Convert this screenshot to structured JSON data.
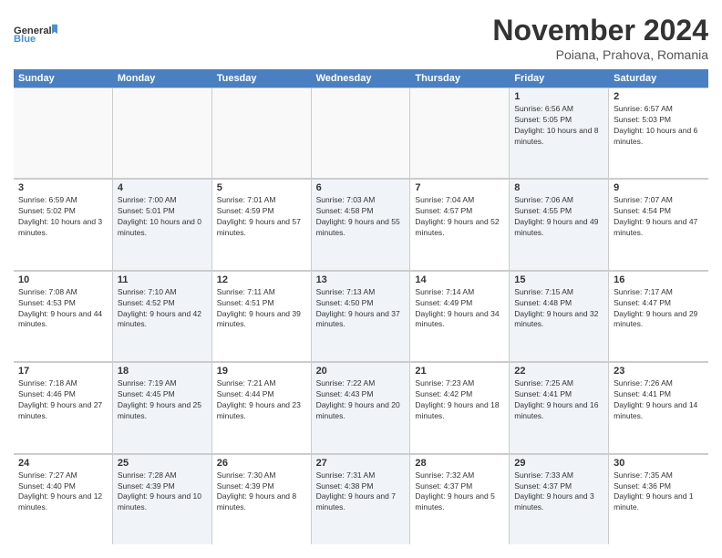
{
  "logo": {
    "general": "General",
    "blue": "Blue"
  },
  "title": "November 2024",
  "location": "Poiana, Prahova, Romania",
  "days": [
    "Sunday",
    "Monday",
    "Tuesday",
    "Wednesday",
    "Thursday",
    "Friday",
    "Saturday"
  ],
  "rows": [
    [
      {
        "day": "",
        "info": "",
        "empty": true
      },
      {
        "day": "",
        "info": "",
        "empty": true
      },
      {
        "day": "",
        "info": "",
        "empty": true
      },
      {
        "day": "",
        "info": "",
        "empty": true
      },
      {
        "day": "",
        "info": "",
        "empty": true
      },
      {
        "day": "1",
        "info": "Sunrise: 6:56 AM\nSunset: 5:05 PM\nDaylight: 10 hours and 8 minutes.",
        "shaded": true
      },
      {
        "day": "2",
        "info": "Sunrise: 6:57 AM\nSunset: 5:03 PM\nDaylight: 10 hours and 6 minutes.",
        "shaded": false
      }
    ],
    [
      {
        "day": "3",
        "info": "Sunrise: 6:59 AM\nSunset: 5:02 PM\nDaylight: 10 hours and 3 minutes.",
        "shaded": false
      },
      {
        "day": "4",
        "info": "Sunrise: 7:00 AM\nSunset: 5:01 PM\nDaylight: 10 hours and 0 minutes.",
        "shaded": true
      },
      {
        "day": "5",
        "info": "Sunrise: 7:01 AM\nSunset: 4:59 PM\nDaylight: 9 hours and 57 minutes.",
        "shaded": false
      },
      {
        "day": "6",
        "info": "Sunrise: 7:03 AM\nSunset: 4:58 PM\nDaylight: 9 hours and 55 minutes.",
        "shaded": true
      },
      {
        "day": "7",
        "info": "Sunrise: 7:04 AM\nSunset: 4:57 PM\nDaylight: 9 hours and 52 minutes.",
        "shaded": false
      },
      {
        "day": "8",
        "info": "Sunrise: 7:06 AM\nSunset: 4:55 PM\nDaylight: 9 hours and 49 minutes.",
        "shaded": true
      },
      {
        "day": "9",
        "info": "Sunrise: 7:07 AM\nSunset: 4:54 PM\nDaylight: 9 hours and 47 minutes.",
        "shaded": false
      }
    ],
    [
      {
        "day": "10",
        "info": "Sunrise: 7:08 AM\nSunset: 4:53 PM\nDaylight: 9 hours and 44 minutes.",
        "shaded": false
      },
      {
        "day": "11",
        "info": "Sunrise: 7:10 AM\nSunset: 4:52 PM\nDaylight: 9 hours and 42 minutes.",
        "shaded": true
      },
      {
        "day": "12",
        "info": "Sunrise: 7:11 AM\nSunset: 4:51 PM\nDaylight: 9 hours and 39 minutes.",
        "shaded": false
      },
      {
        "day": "13",
        "info": "Sunrise: 7:13 AM\nSunset: 4:50 PM\nDaylight: 9 hours and 37 minutes.",
        "shaded": true
      },
      {
        "day": "14",
        "info": "Sunrise: 7:14 AM\nSunset: 4:49 PM\nDaylight: 9 hours and 34 minutes.",
        "shaded": false
      },
      {
        "day": "15",
        "info": "Sunrise: 7:15 AM\nSunset: 4:48 PM\nDaylight: 9 hours and 32 minutes.",
        "shaded": true
      },
      {
        "day": "16",
        "info": "Sunrise: 7:17 AM\nSunset: 4:47 PM\nDaylight: 9 hours and 29 minutes.",
        "shaded": false
      }
    ],
    [
      {
        "day": "17",
        "info": "Sunrise: 7:18 AM\nSunset: 4:46 PM\nDaylight: 9 hours and 27 minutes.",
        "shaded": false
      },
      {
        "day": "18",
        "info": "Sunrise: 7:19 AM\nSunset: 4:45 PM\nDaylight: 9 hours and 25 minutes.",
        "shaded": true
      },
      {
        "day": "19",
        "info": "Sunrise: 7:21 AM\nSunset: 4:44 PM\nDaylight: 9 hours and 23 minutes.",
        "shaded": false
      },
      {
        "day": "20",
        "info": "Sunrise: 7:22 AM\nSunset: 4:43 PM\nDaylight: 9 hours and 20 minutes.",
        "shaded": true
      },
      {
        "day": "21",
        "info": "Sunrise: 7:23 AM\nSunset: 4:42 PM\nDaylight: 9 hours and 18 minutes.",
        "shaded": false
      },
      {
        "day": "22",
        "info": "Sunrise: 7:25 AM\nSunset: 4:41 PM\nDaylight: 9 hours and 16 minutes.",
        "shaded": true
      },
      {
        "day": "23",
        "info": "Sunrise: 7:26 AM\nSunset: 4:41 PM\nDaylight: 9 hours and 14 minutes.",
        "shaded": false
      }
    ],
    [
      {
        "day": "24",
        "info": "Sunrise: 7:27 AM\nSunset: 4:40 PM\nDaylight: 9 hours and 12 minutes.",
        "shaded": false
      },
      {
        "day": "25",
        "info": "Sunrise: 7:28 AM\nSunset: 4:39 PM\nDaylight: 9 hours and 10 minutes.",
        "shaded": true
      },
      {
        "day": "26",
        "info": "Sunrise: 7:30 AM\nSunset: 4:39 PM\nDaylight: 9 hours and 8 minutes.",
        "shaded": false
      },
      {
        "day": "27",
        "info": "Sunrise: 7:31 AM\nSunset: 4:38 PM\nDaylight: 9 hours and 7 minutes.",
        "shaded": true
      },
      {
        "day": "28",
        "info": "Sunrise: 7:32 AM\nSunset: 4:37 PM\nDaylight: 9 hours and 5 minutes.",
        "shaded": false
      },
      {
        "day": "29",
        "info": "Sunrise: 7:33 AM\nSunset: 4:37 PM\nDaylight: 9 hours and 3 minutes.",
        "shaded": true
      },
      {
        "day": "30",
        "info": "Sunrise: 7:35 AM\nSunset: 4:36 PM\nDaylight: 9 hours and 1 minute.",
        "shaded": false
      }
    ]
  ]
}
